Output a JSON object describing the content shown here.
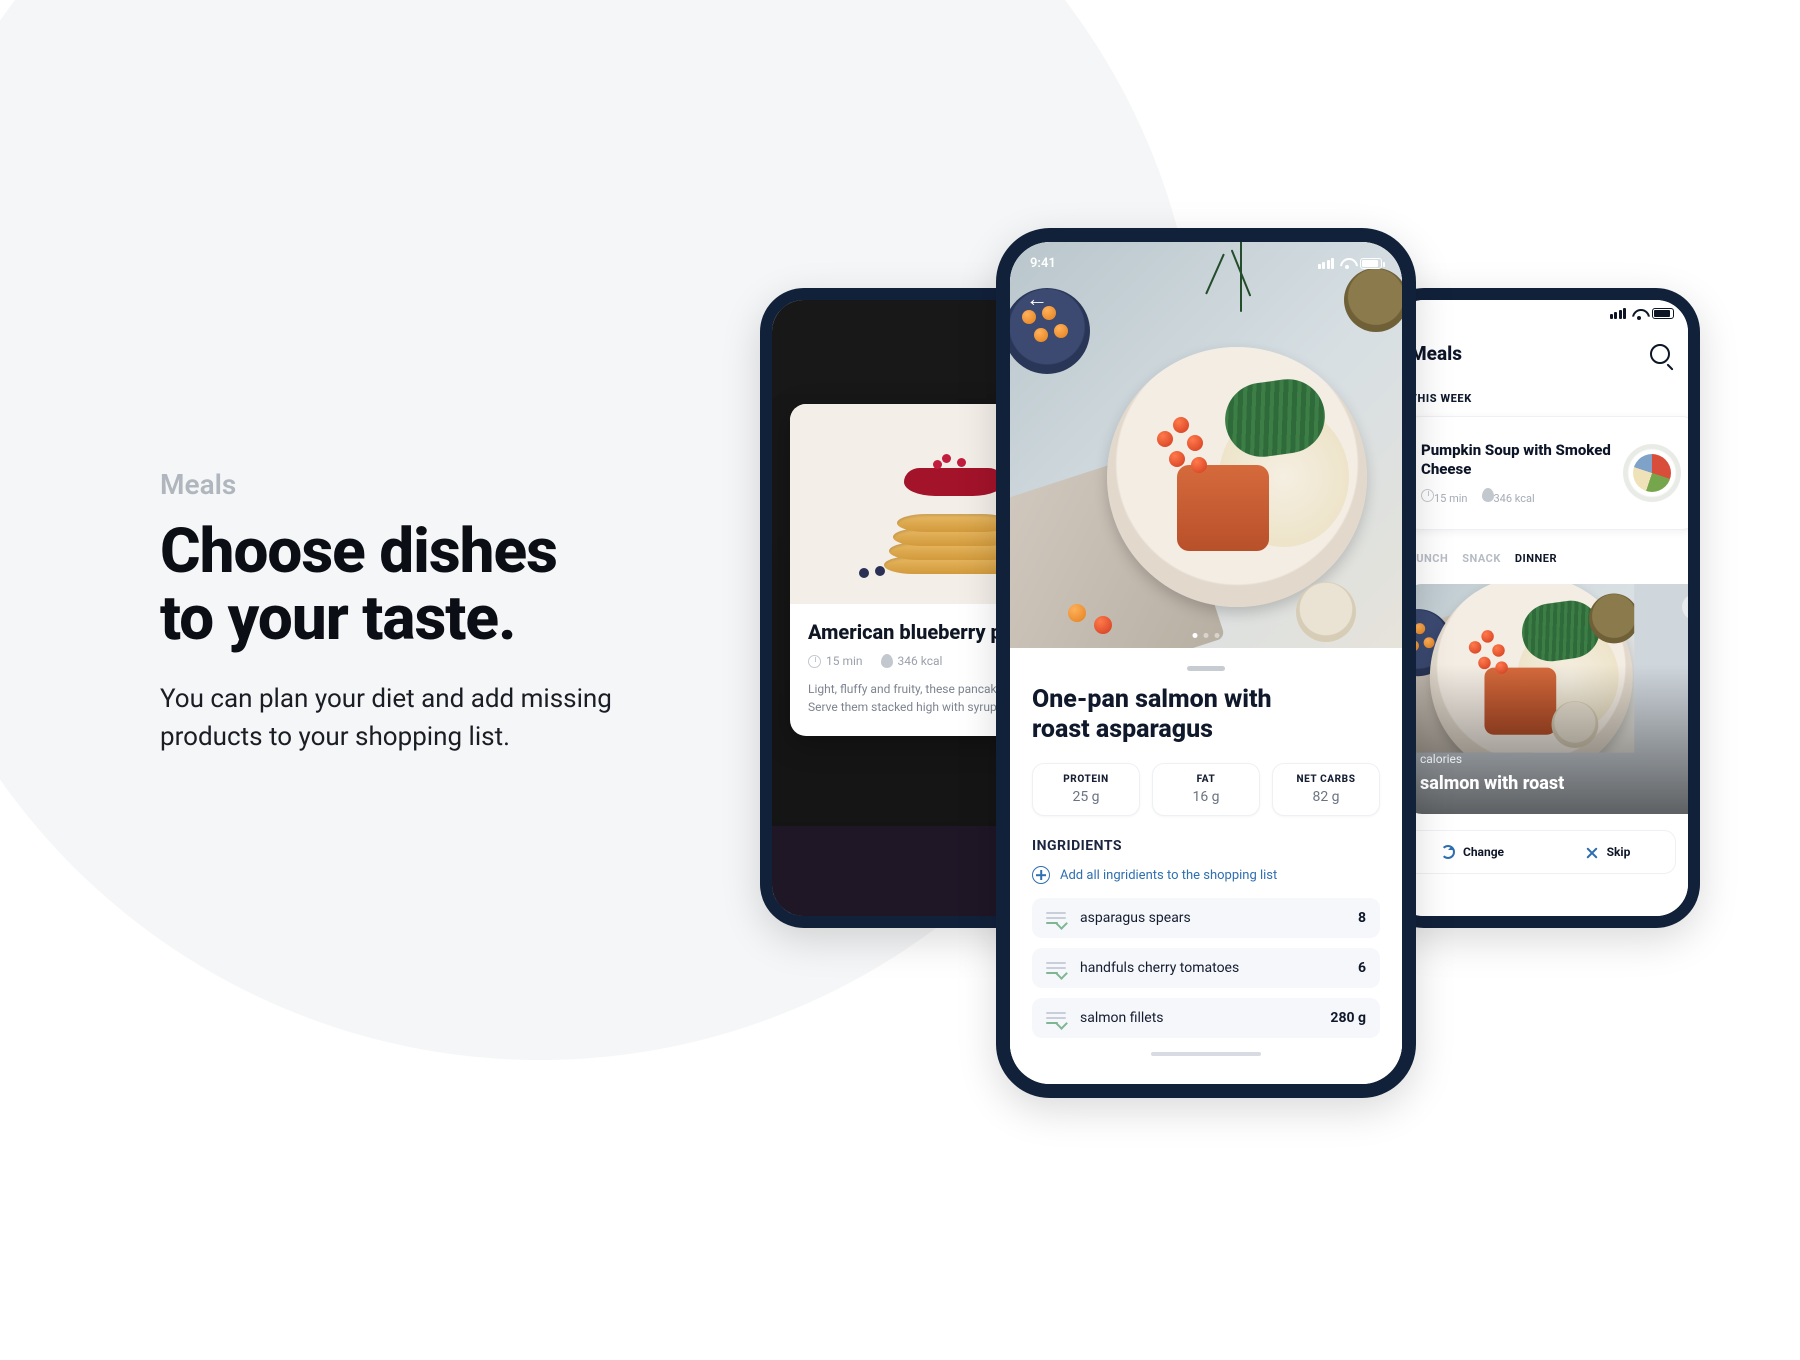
{
  "marketing": {
    "eyebrow": "Meals",
    "headline_l1": "Choose dishes",
    "headline_l2": "to your taste.",
    "subhead": "You can plan your diet and add missing products to your shopping list."
  },
  "phone_left": {
    "card_title": "American blueberry pancakes",
    "meta_time": "15 min",
    "meta_kcal": "346 kcal",
    "description": "Light, fluffy and fruity, these pancakes are a US classic. Serve them stacked high with syrup and extra fruit."
  },
  "phone_center": {
    "status_time": "9:41",
    "dish_title_l1": "One-pan salmon with",
    "dish_title_l2": "roast asparagus",
    "macros": [
      {
        "label": "PROTEIN",
        "value": "25 g"
      },
      {
        "label": "FAT",
        "value": "16 g"
      },
      {
        "label": "NET CARBS",
        "value": "82 g"
      }
    ],
    "ingredients_heading": "INGRIDIENTS",
    "add_all_label": "Add all ingridients to the shopping list",
    "ingredients": [
      {
        "name": "asparagus spears",
        "qty": "8"
      },
      {
        "name": "handfuls cherry tomatoes",
        "qty": "6"
      },
      {
        "name": "salmon fillets",
        "qty": "280 g"
      }
    ]
  },
  "phone_right": {
    "header_title": "Meals",
    "section_label": "THIS WEEK",
    "featured_title": "Pumpkin Soup with Smoked Cheese",
    "featured_time": "15 min",
    "featured_kcal": "346 kcal",
    "tabs": [
      "LUNCH",
      "SNACK",
      "DINNER"
    ],
    "big_card_kicker": "calories",
    "big_card_title": "salmon with roast",
    "action_change": "Change",
    "action_skip": "Skip"
  }
}
